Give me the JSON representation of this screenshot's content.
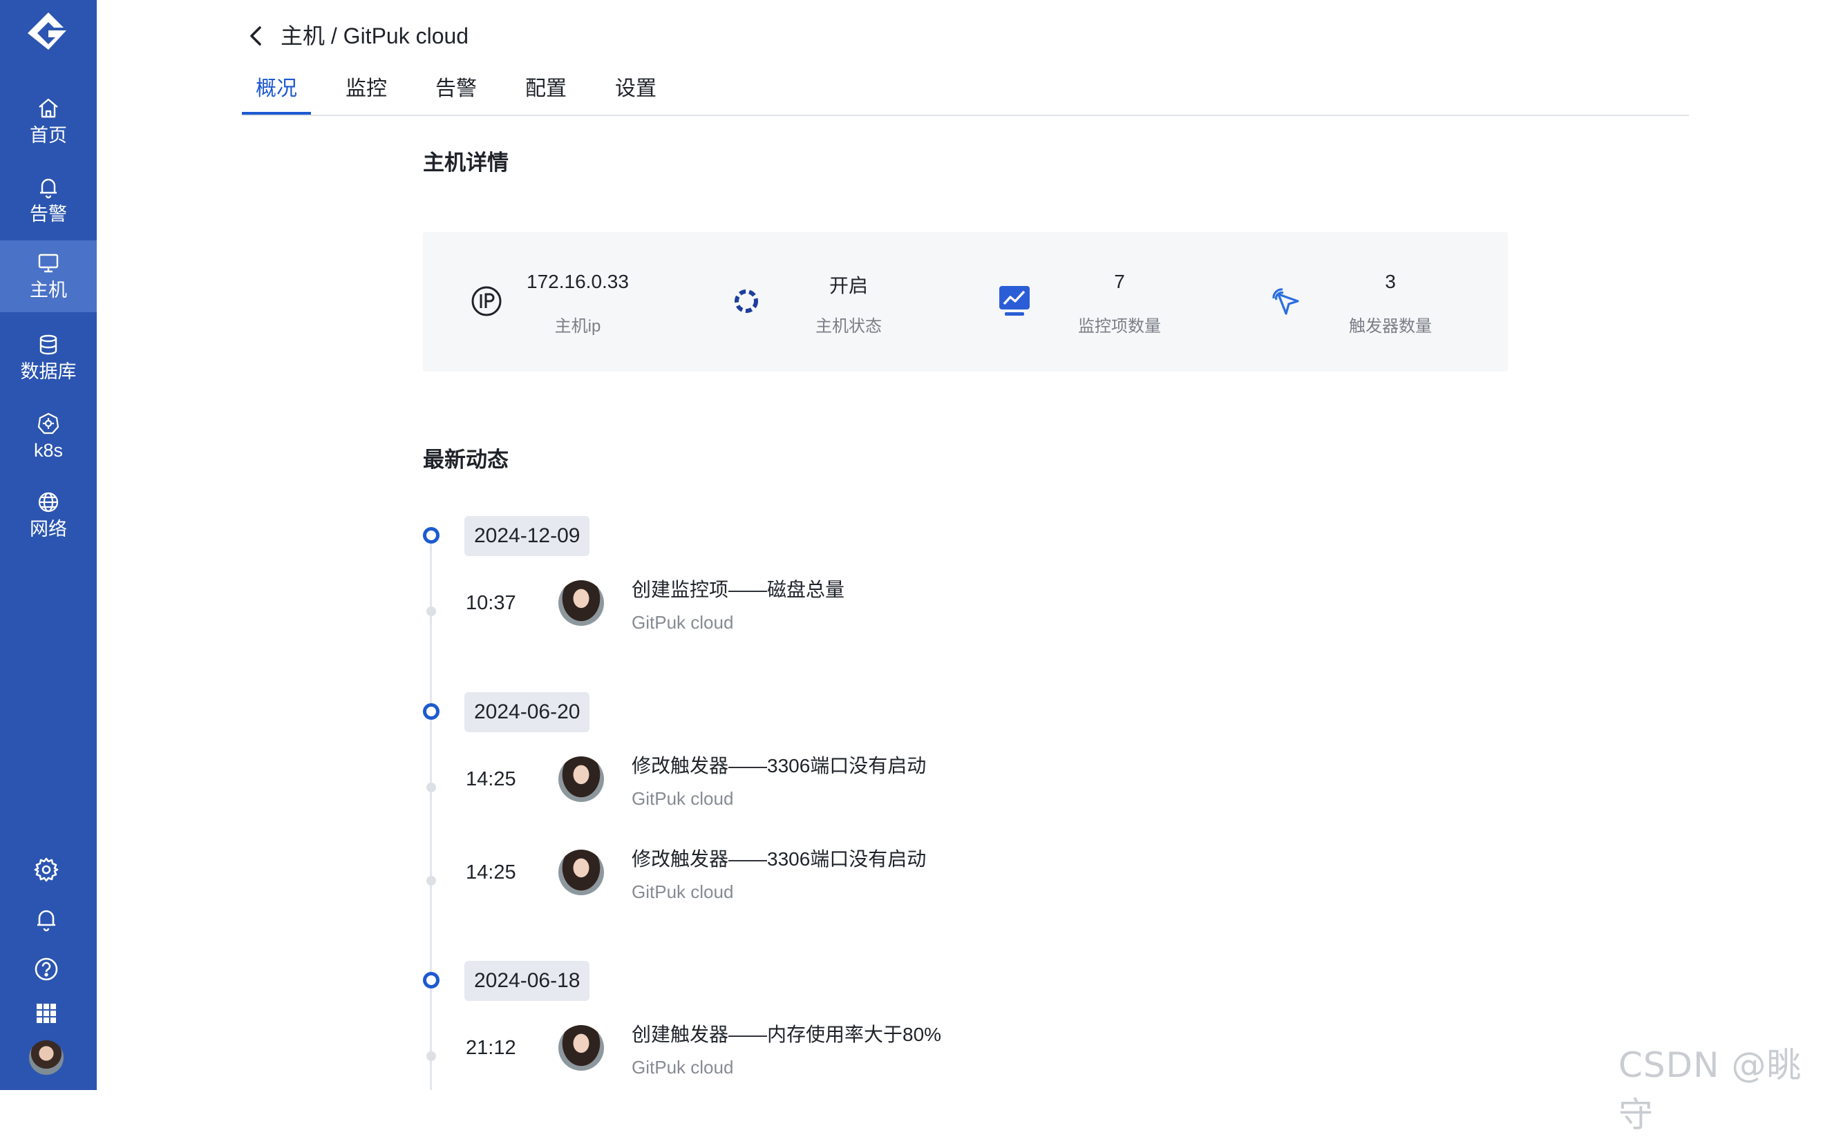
{
  "sidebar": {
    "logo_icon": "gitpuk-logo",
    "items": [
      {
        "label": "首页",
        "icon": "home-icon"
      },
      {
        "label": "告警",
        "icon": "bell-icon"
      },
      {
        "label": "主机",
        "icon": "monitor-icon",
        "active": true
      },
      {
        "label": "数据库",
        "icon": "database-icon"
      },
      {
        "label": "k8s",
        "icon": "k8s-icon"
      },
      {
        "label": "网络",
        "icon": "globe-icon"
      }
    ],
    "bottom_icons": [
      "gear-icon",
      "bell-icon",
      "help-icon",
      "apps-grid-icon",
      "avatar"
    ]
  },
  "header": {
    "breadcrumb": "主机 / GitPuk cloud",
    "tabs": [
      "概况",
      "监控",
      "告警",
      "配置",
      "设置"
    ],
    "active_tab": "概况"
  },
  "host_details": {
    "title": "主机详情",
    "stats": [
      {
        "value": "172.16.0.33",
        "label": "主机ip",
        "icon": "ip-icon"
      },
      {
        "value": "开启",
        "label": "主机状态",
        "icon": "status-ring-icon"
      },
      {
        "value": "7",
        "label": "监控项数量",
        "icon": "chart-monitor-icon"
      },
      {
        "value": "3",
        "label": "触发器数量",
        "icon": "cursor-click-icon"
      }
    ]
  },
  "activity": {
    "title": "最新动态",
    "groups": [
      {
        "date": "2024-12-09",
        "events": [
          {
            "time": "10:37",
            "title": "创建监控项——磁盘总量",
            "user": "GitPuk cloud"
          }
        ]
      },
      {
        "date": "2024-06-20",
        "events": [
          {
            "time": "14:25",
            "title": "修改触发器——3306端口没有启动",
            "user": "GitPuk cloud"
          },
          {
            "time": "14:25",
            "title": "修改触发器——3306端口没有启动",
            "user": "GitPuk cloud"
          }
        ]
      },
      {
        "date": "2024-06-18",
        "events": [
          {
            "time": "21:12",
            "title": "创建触发器——内存使用率大于80%",
            "user": "GitPuk cloud"
          }
        ]
      }
    ]
  },
  "watermark": "CSDN @眺守",
  "colors": {
    "sidebar": "#2b55b0",
    "sidebar_active": "#4a72c7",
    "accent": "#1d5ad0",
    "card_bg": "#f6f7f9"
  }
}
